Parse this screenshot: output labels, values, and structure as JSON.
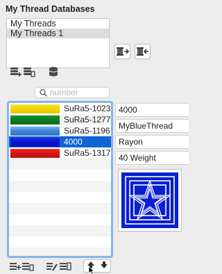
{
  "panel": {
    "title": "My Thread Databases"
  },
  "databases": {
    "items": [
      {
        "label": "My Threads",
        "selected": false
      },
      {
        "label": "My Threads 1",
        "selected": true
      }
    ]
  },
  "db_buttons": {
    "move_right_icon": "spool-arrow-right-icon",
    "move_left_icon": "spool-arrow-left-icon"
  },
  "db_tools": {
    "add_icon": "add-database-icon",
    "remove_icon": "remove-database-icon",
    "info_icon": "database-icon"
  },
  "search": {
    "placeholder": "number",
    "value": ""
  },
  "threads": [
    {
      "name": "SuRa5-1023",
      "swatch": [
        "#f3d600",
        "#f7e34a",
        "#e5c200"
      ],
      "selected": false
    },
    {
      "name": "SuRa5-1277",
      "swatch": [
        "#0c7d1f",
        "#189a2d",
        "#0a6d1a"
      ],
      "selected": false
    },
    {
      "name": "SuRa5-1196",
      "swatch": [
        "#3f86d8",
        "#7fb6ee",
        "#2e73c6"
      ],
      "selected": false
    },
    {
      "name": "4000",
      "swatch": [
        "#0a14c8",
        "#1530f0",
        "#0812b8"
      ],
      "selected": true
    },
    {
      "name": "SuRa5-1317",
      "swatch": [
        "#d41616",
        "#f03030",
        "#c01010"
      ],
      "selected": false
    }
  ],
  "details": {
    "number": "4000",
    "name": "MyBlueThread",
    "material": "Rayon",
    "weight": "40 Weight"
  },
  "preview": {
    "color": "#0a1fd0",
    "motif": "star-icon"
  },
  "bottom_toolbar": {
    "icons": [
      "add-thread-icon",
      "remove-thread-icon",
      "edit-thread-icon",
      "sort-list-icon",
      "move-up-icon",
      "move-down-icon"
    ]
  }
}
